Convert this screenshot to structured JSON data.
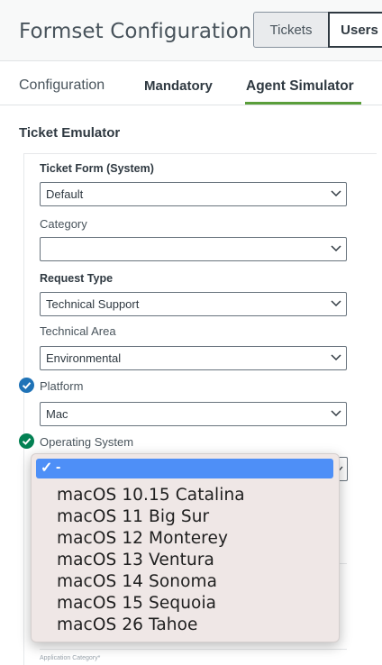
{
  "header": {
    "title": "Formset Configuration",
    "buttons": {
      "tickets": "Tickets",
      "users": "Users"
    }
  },
  "tabs": [
    {
      "label": "Configuration"
    },
    {
      "label": "Mandatory"
    },
    {
      "label": "Agent Simulator",
      "active": true
    }
  ],
  "section": {
    "title": "Ticket Emulator"
  },
  "fields": {
    "ticket_form": {
      "label": "Ticket Form (System)",
      "value": "Default"
    },
    "category": {
      "label": "Category",
      "value": ""
    },
    "request_type": {
      "label": "Request Type",
      "value": "Technical Support"
    },
    "technical_area": {
      "label": "Technical Area",
      "value": "Environmental"
    },
    "platform": {
      "label": "Platform",
      "value": "Mac"
    },
    "operating_system": {
      "label": "Operating System"
    }
  },
  "dropdown": {
    "selected": "-",
    "options": [
      "macOS 10.15 Catalina",
      "macOS 11  Big Sur",
      "macOS 12 Monterey",
      "macOS 13 Ventura",
      "macOS 14 Sonoma",
      "macOS 15 Sequoia",
      "macOS 26 Tahoe"
    ]
  },
  "footer_hint": "Application Category*",
  "colors": {
    "accent_tab": "#5a9e3a",
    "check_platform": "#1f73b7",
    "check_os": "#038153",
    "dropdown_highlight": "#4e8ff7"
  }
}
